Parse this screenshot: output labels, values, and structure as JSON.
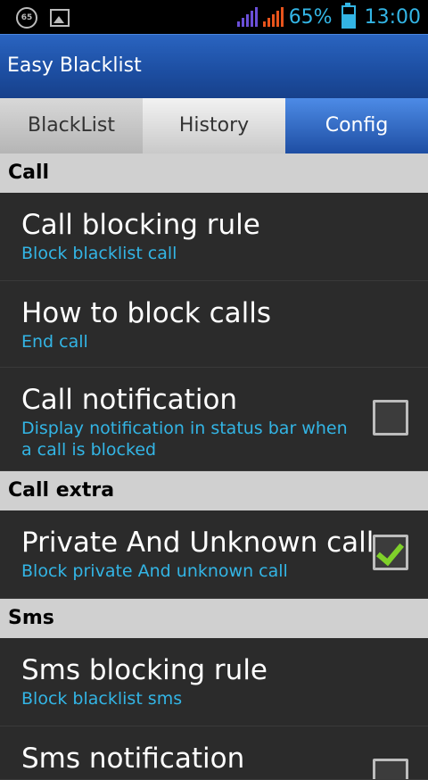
{
  "status_bar": {
    "badge": "65",
    "battery_percent": "65%",
    "battery_level": 0.65,
    "time": "13:00",
    "signal_colors": [
      "#6a4fd8",
      "#e8541c"
    ]
  },
  "app": {
    "title": "Easy Blacklist"
  },
  "tabs": [
    {
      "label": "BlackList",
      "active": false
    },
    {
      "label": "History",
      "active": false
    },
    {
      "label": "Config",
      "active": true
    }
  ],
  "sections": [
    {
      "header": "Call",
      "items": [
        {
          "title": "Call blocking rule",
          "summary": "Block blacklist call"
        },
        {
          "title": "How to block calls",
          "summary": "End call"
        },
        {
          "title": "Call notification",
          "summary": "Display notification in status bar when a call is blocked",
          "checked": false
        }
      ]
    },
    {
      "header": "Call extra",
      "items": [
        {
          "title": "Private And Unknown call",
          "summary": "Block private And unknown call",
          "checked": true
        }
      ]
    },
    {
      "header": "Sms",
      "items": [
        {
          "title": "Sms blocking rule",
          "summary": "Block blacklist sms"
        },
        {
          "title": "Sms notification"
        }
      ]
    }
  ],
  "colors": {
    "accent": "#33b5e5",
    "action_bar": "#1d4fa3",
    "check": "#7fd12a"
  }
}
